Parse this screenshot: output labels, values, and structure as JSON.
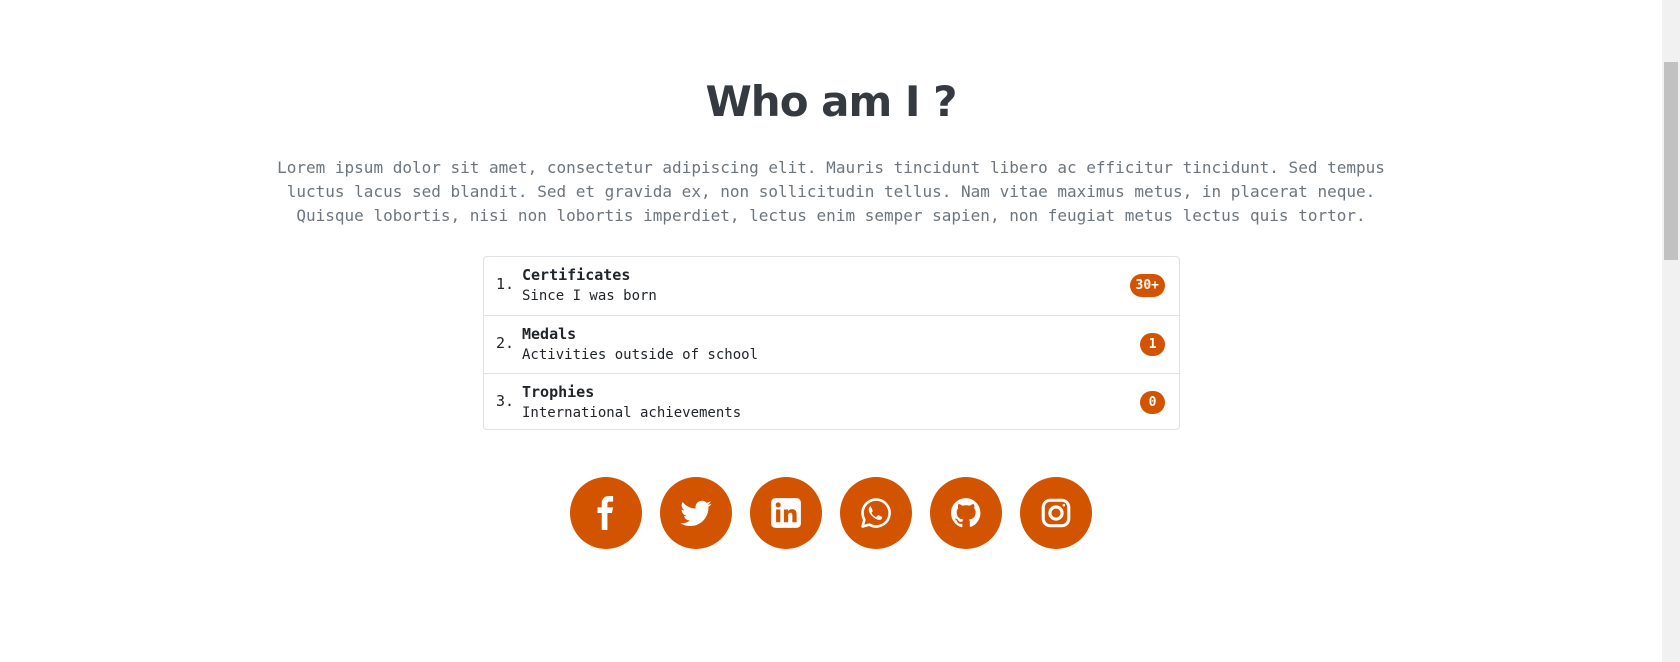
{
  "about": {
    "title": "Who am I ?",
    "text": "Lorem ipsum dolor sit amet, consectetur adipiscing elit. Mauris tincidunt libero ac efficitur tincidunt. Sed tempus luctus lacus sed blandit. Sed et gravida ex, non sollicitudin tellus. Nam vitae maximus metus, in placerat neque. Quisque lobortis, nisi non lobortis imperdiet, lectus enim semper sapien, non feugiat metus lectus quis tortor."
  },
  "achievements": [
    {
      "number": "1.",
      "title": "Certificates",
      "subtitle": "Since I was born",
      "badge": "30+"
    },
    {
      "number": "2.",
      "title": "Medals",
      "subtitle": "Activities outside of school",
      "badge": "1"
    },
    {
      "number": "3.",
      "title": "Trophies",
      "subtitle": "International achievements",
      "badge": "0"
    }
  ],
  "socials": [
    {
      "icon": "facebook-icon"
    },
    {
      "icon": "twitter-icon"
    },
    {
      "icon": "linkedin-icon"
    },
    {
      "icon": "whatsapp-icon"
    },
    {
      "icon": "github-icon"
    },
    {
      "icon": "instagram-icon"
    }
  ],
  "colors": {
    "accent": "#d35400",
    "title": "#343a40",
    "text": "#6c757d"
  }
}
